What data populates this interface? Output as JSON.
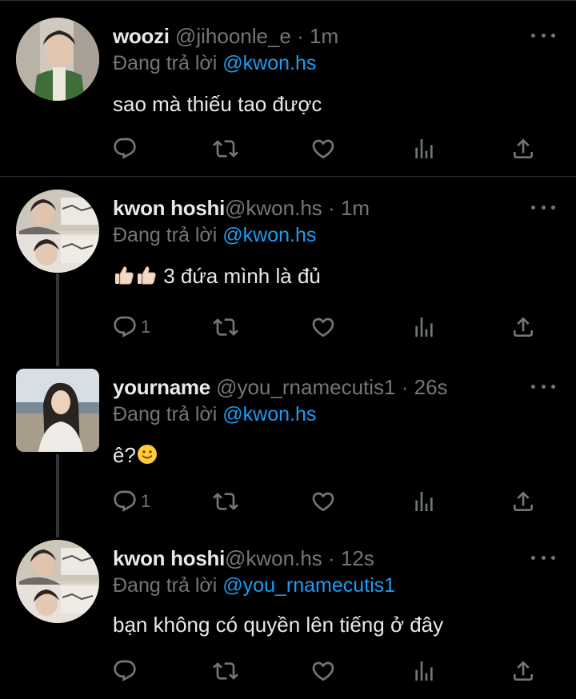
{
  "tweets": [
    {
      "name": "woozi",
      "handle": "@jihoonle_e",
      "sep": "·",
      "time": "1m",
      "replying_prefix": "Đang trả lời",
      "replying_to": "@kwon.hs",
      "text": "sao mà thiếu tao được",
      "reply_count": ""
    },
    {
      "name": "kwon hoshi",
      "handle": "@kwon.hs",
      "sep": "·",
      "time": "1m",
      "replying_prefix": "Đang trả lời",
      "replying_to": "@kwon.hs",
      "text": "3 đứa mình là đủ",
      "reply_count": "1"
    },
    {
      "name": "yourname",
      "handle": "@you_rnamecutis1",
      "sep": "·",
      "time": "26s",
      "replying_prefix": "Đang trả lời",
      "replying_to": "@kwon.hs",
      "text": "ê?",
      "reply_count": "1"
    },
    {
      "name": "kwon hoshi",
      "handle": "@kwon.hs",
      "sep": "·",
      "time": "12s",
      "replying_prefix": "Đang trả lời",
      "replying_to": "@you_rnamecutis1",
      "text": "bạn không có quyền lên tiếng ở đây",
      "reply_count": ""
    }
  ],
  "icons": {
    "reply": "reply-icon",
    "retweet": "retweet-icon",
    "like": "like-icon",
    "views": "views-icon",
    "share": "share-icon",
    "more": "more-icon"
  },
  "colors": {
    "background": "#000000",
    "text": "#e7e9ea",
    "muted": "#71767b",
    "link": "#1d9bf0",
    "divider": "#2f3336"
  }
}
